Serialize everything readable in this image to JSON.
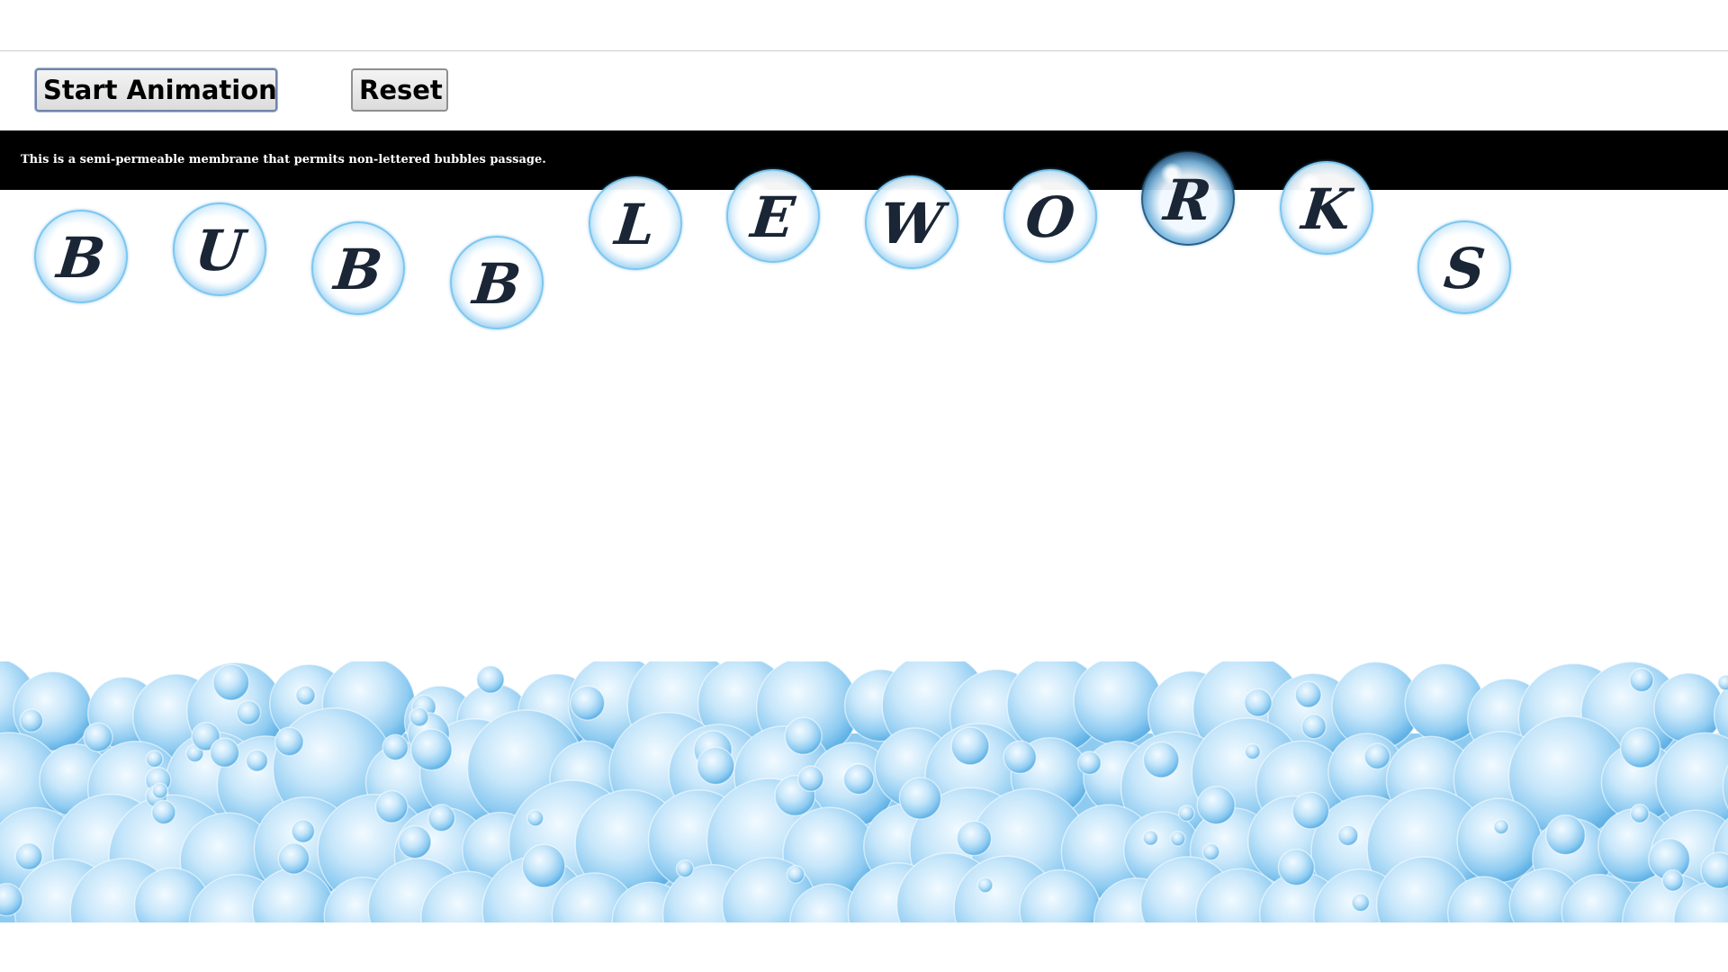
{
  "controls": {
    "start_label": "Start Animation",
    "reset_label": "Reset"
  },
  "membrane": {
    "text": "This is a semi-permeable membrane that permits non-lettered bubbles passage."
  },
  "bubbles": [
    {
      "letter": "B"
    },
    {
      "letter": "U"
    },
    {
      "letter": "B"
    },
    {
      "letter": "B"
    },
    {
      "letter": "L"
    },
    {
      "letter": "E"
    },
    {
      "letter": "W"
    },
    {
      "letter": "O"
    },
    {
      "letter": "R"
    },
    {
      "letter": "K"
    },
    {
      "letter": "S"
    }
  ],
  "colors": {
    "membrane": "#000000",
    "bubble_rim": "#7cc6ef",
    "letter": "#1a2535",
    "foam": "#9fd3f3"
  }
}
